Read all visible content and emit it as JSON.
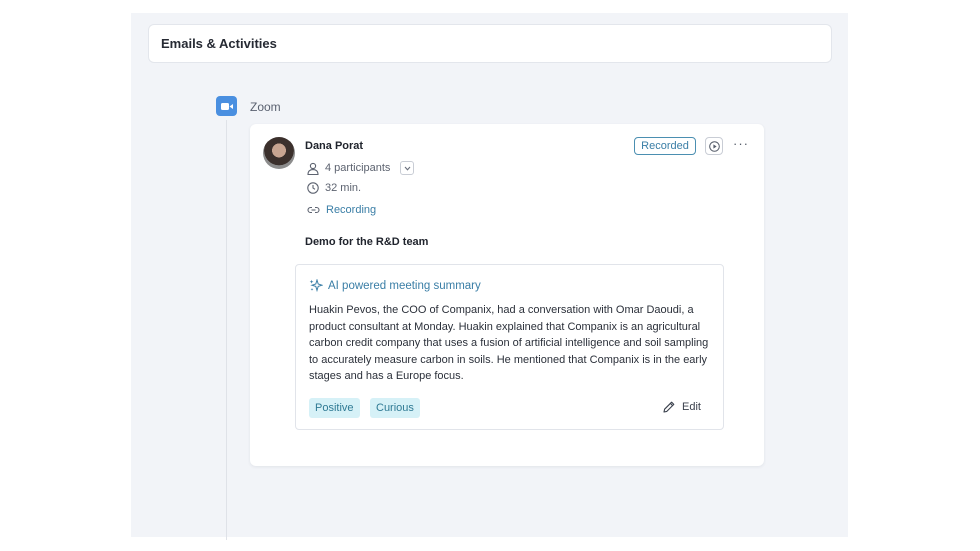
{
  "section": {
    "title": "Emails & Activities"
  },
  "source": {
    "name": "Zoom",
    "icon": "zoom-video-icon",
    "color": "#4a8fe0"
  },
  "activity": {
    "author": "Dana Porat",
    "participants_label": "4 participants",
    "duration_label": "32 min.",
    "recording_link": "Recording",
    "status_badge": "Recorded",
    "meeting_title": "Demo for the R&D team",
    "more_label": "···"
  },
  "summary": {
    "heading": "AI powered meeting summary",
    "text": "Huakin Pevos, the COO of Companix, had a conversation with Omar Daoudi, a product consultant at Monday. Huakin explained that Companix is an agricultural carbon credit company that uses a fusion of artificial intelligence and soil sampling to accurately measure carbon in soils. He mentioned that Companix is in the early stages and has a Europe focus.",
    "tags": [
      "Positive",
      "Curious"
    ],
    "edit_label": "Edit"
  },
  "colors": {
    "accent": "#3a7ea6",
    "tag_bg": "#d6f1f7",
    "panel_bg": "#f2f4f8"
  }
}
